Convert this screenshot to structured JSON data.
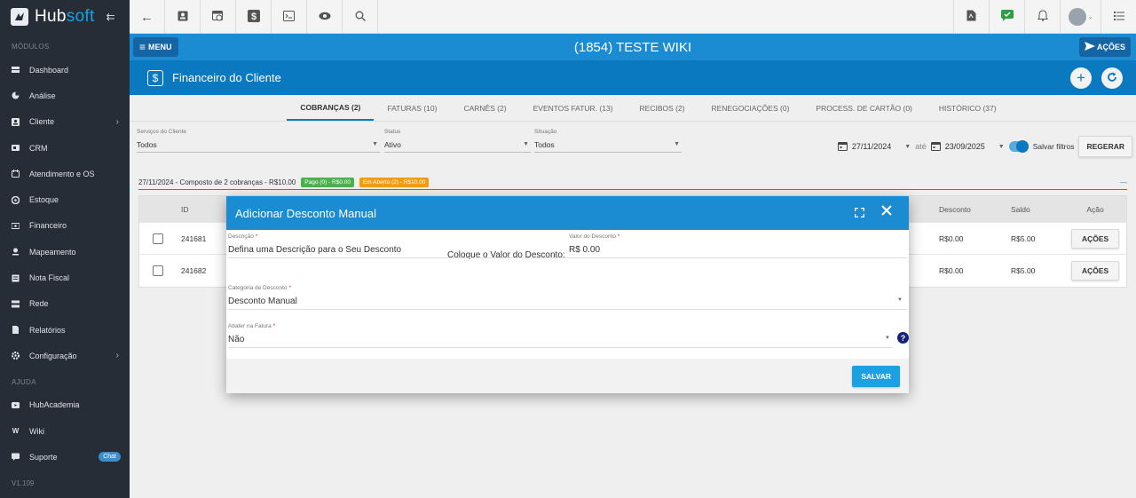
{
  "sidebar": {
    "logo_prefix": "Hub",
    "logo_suffix": "soft",
    "section_modules": "MÓDULOS",
    "items": [
      {
        "label": "Dashboard",
        "icon": "dashboard-icon"
      },
      {
        "label": "Análise",
        "icon": "analytics-icon"
      },
      {
        "label": "Cliente",
        "icon": "client-icon",
        "submenu": true
      },
      {
        "label": "CRM",
        "icon": "crm-icon"
      },
      {
        "label": "Atendimento e OS",
        "icon": "support-ticket-icon"
      },
      {
        "label": "Estoque",
        "icon": "stock-icon"
      },
      {
        "label": "Financeiro",
        "icon": "finance-icon"
      },
      {
        "label": "Mapeamento",
        "icon": "map-pin-icon"
      },
      {
        "label": "Nota Fiscal",
        "icon": "invoice-icon"
      },
      {
        "label": "Rede",
        "icon": "network-icon"
      },
      {
        "label": "Relatórios",
        "icon": "report-icon"
      },
      {
        "label": "Configuração",
        "icon": "settings-icon",
        "submenu": true
      }
    ],
    "section_help": "AJUDA",
    "help_items": [
      {
        "label": "HubAcademia",
        "icon": "video-icon"
      },
      {
        "label": "Wiki",
        "icon": "wiki-icon"
      },
      {
        "label": "Suporte",
        "icon": "chat-icon",
        "badge": "Chat"
      }
    ],
    "version": "V1.109"
  },
  "client": {
    "menu_label": "MENU",
    "title": "(1854) TESTE WIKI",
    "actions_label": "AÇÕES"
  },
  "section": {
    "icon_glyph": "$",
    "title": "Financeiro do Cliente"
  },
  "tabs": [
    {
      "label": "COBRANÇAS (2)",
      "active": true
    },
    {
      "label": "FATURAS (10)"
    },
    {
      "label": "CARNÊS (2)"
    },
    {
      "label": "EVENTOS FATUR. (13)"
    },
    {
      "label": "RECIBOS (2)"
    },
    {
      "label": "RENEGOCIAÇÕES (0)"
    },
    {
      "label": "PROCESS. DE CARTÃO (0)"
    },
    {
      "label": "HISTÓRICO (37)"
    }
  ],
  "filters": {
    "servicos": {
      "label": "Serviços do Cliente",
      "value": "Todos"
    },
    "status": {
      "label": "Status",
      "value": "Ativo"
    },
    "situacao": {
      "label": "Situação",
      "value": "Todos"
    },
    "date_from": "27/11/2024",
    "date_sep": "até",
    "date_to": "23/09/2025",
    "save_filters": "Salvar filtros",
    "regerar": "REGERAR"
  },
  "group": {
    "text": "27/11/2024 - Composto de 2 cobranças - R$10.00",
    "badge_paid": "Pago (0) - R$0.00",
    "badge_open": "Em Aberto (2) - R$10.00",
    "toggle": "—"
  },
  "table": {
    "headers": {
      "id": "ID",
      "desconto": "Desconto",
      "saldo": "Saldo",
      "acao": "Ação"
    },
    "rows": [
      {
        "id": "241681",
        "desconto": "R$0.00",
        "saldo": "R$5.00",
        "action": "AÇÕES"
      },
      {
        "id": "241682",
        "desconto": "R$0.00",
        "saldo": "R$5.00",
        "action": "AÇÕES"
      }
    ]
  },
  "modal": {
    "title": "Adicionar Desconto Manual",
    "descricao_label": "Descrição",
    "descricao_value": "Defina uma Descrição para o Seu Desconto",
    "valor_hint": "Coloque o Valor do Desconto:",
    "valor_label": "Valor do Desconto",
    "valor_value": "R$ 0.00",
    "categoria_label": "Categoria de Desconto",
    "categoria_value": "Desconto Manual",
    "abater_label": "Abater na Fatura",
    "abater_value": "Não",
    "required_mark": "*",
    "save_label": "SALVAR"
  },
  "colors": {
    "sidebar_bg": "#262d36",
    "primary": "#1b8bd2",
    "header_dark": "#0a79bf",
    "badge_paid": "#4caf50",
    "badge_open": "#f39c12",
    "save_button": "#1ba1e2"
  }
}
